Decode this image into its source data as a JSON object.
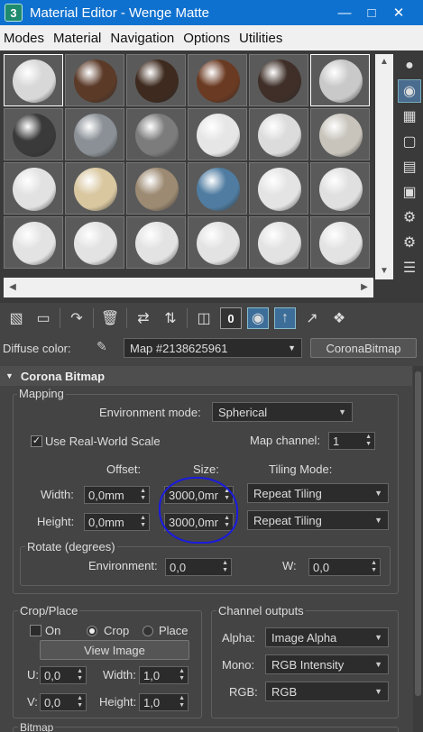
{
  "window": {
    "title": "Material Editor - Wenge Matte",
    "app_icon": "3"
  },
  "menu": [
    "Modes",
    "Material",
    "Navigation",
    "Options",
    "Utilities"
  ],
  "slots": [
    {
      "color": "#d8d8d8"
    },
    {
      "color": "#5b3a28"
    },
    {
      "color": "#3e2a1e"
    },
    {
      "color": "#6a3a22"
    },
    {
      "color": "#3f2f28"
    },
    {
      "color": "#c9c9c9"
    },
    {
      "color": "#3a3a3a"
    },
    {
      "color": "#8a9096"
    },
    {
      "color": "#7c7c7c"
    },
    {
      "color": "#e6e6e6"
    },
    {
      "color": "#dcdcdc"
    },
    {
      "color": "#c8c4bc"
    },
    {
      "color": "#e2e2e2"
    },
    {
      "color": "#d9c7a0"
    },
    {
      "color": "#9c8a72"
    },
    {
      "color": "#4f7ca0"
    },
    {
      "color": "#e4e4e4"
    },
    {
      "color": "#e0e0e0"
    },
    {
      "color": "#e3e3e3"
    },
    {
      "color": "#e3e3e3"
    },
    {
      "color": "#e3e3e3"
    },
    {
      "color": "#e3e3e3"
    },
    {
      "color": "#e3e3e3"
    },
    {
      "color": "#e3e3e3"
    }
  ],
  "toolbar": {
    "zero_label": "0"
  },
  "diffuse": {
    "label": "Diffuse color:",
    "map_name": "Map #2138625961",
    "type_button": "CoronaBitmap"
  },
  "rollout": {
    "title": "Corona Bitmap"
  },
  "mapping": {
    "group_title": "Mapping",
    "env_mode_label": "Environment mode:",
    "env_mode_value": "Spherical",
    "use_real_world_label": "Use Real-World Scale",
    "use_real_world_checked": true,
    "map_channel_label": "Map channel:",
    "map_channel_value": "1",
    "offset_header": "Offset:",
    "size_header": "Size:",
    "tiling_header": "Tiling Mode:",
    "width_label": "Width:",
    "height_label": "Height:",
    "width_offset": "0,0mm",
    "height_offset": "0,0mm",
    "width_size": "3000,0mr",
    "height_size": "3000,0mr",
    "width_tiling": "Repeat Tiling",
    "height_tiling": "Repeat Tiling",
    "rotate_title": "Rotate (degrees)",
    "environment_label": "Environment:",
    "environment_value": "0,0",
    "w_label": "W:",
    "w_value": "0,0"
  },
  "crop": {
    "group_title": "Crop/Place",
    "on_label": "On",
    "crop_label": "Crop",
    "place_label": "Place",
    "view_image_label": "View Image",
    "u_label": "U:",
    "u_value": "0,0",
    "v_label": "V:",
    "v_value": "0,0",
    "width_label": "Width:",
    "width_value": "1,0",
    "height_label": "Height:",
    "height_value": "1,0"
  },
  "channel_outputs": {
    "group_title": "Channel outputs",
    "alpha_label": "Alpha:",
    "alpha_value": "Image Alpha",
    "mono_label": "Mono:",
    "mono_value": "RGB Intensity",
    "rgb_label": "RGB:",
    "rgb_value": "RGB"
  },
  "bitmap_group_title": "Bitmap"
}
